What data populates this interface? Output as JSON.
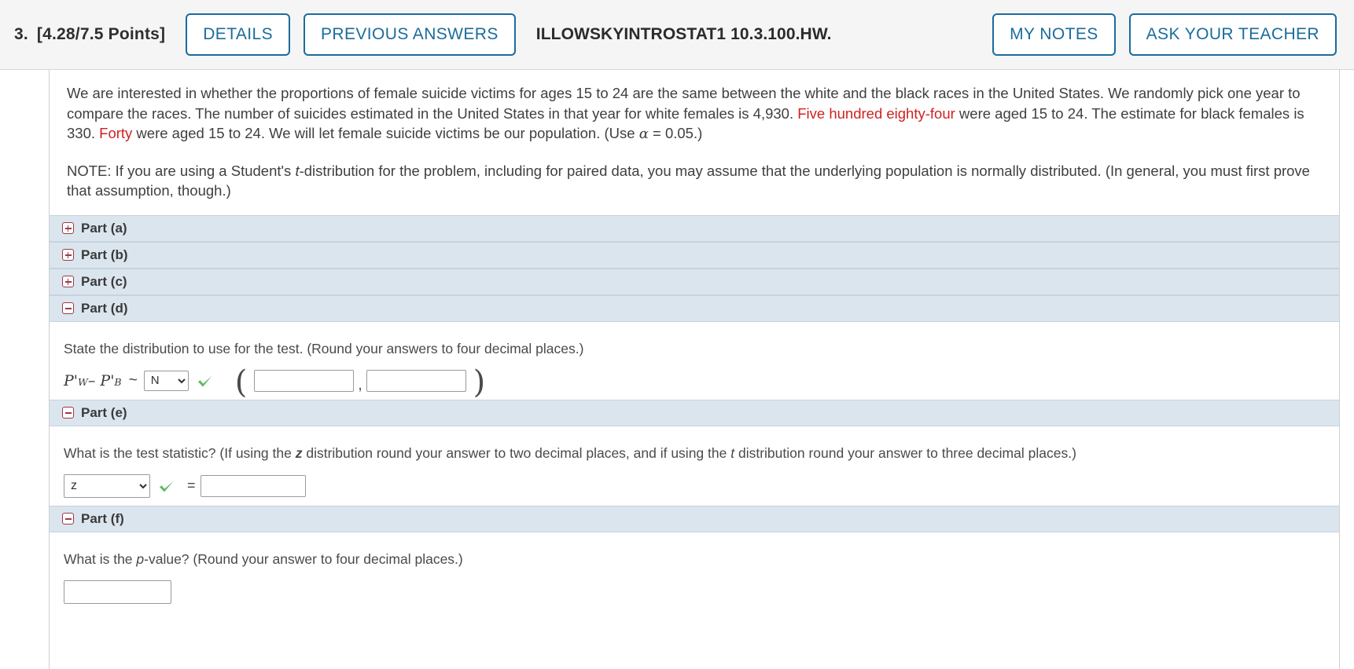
{
  "header": {
    "number": "3.",
    "points": "[4.28/7.5 Points]",
    "details_label": "DETAILS",
    "previous_answers_label": "PREVIOUS ANSWERS",
    "question_code": "ILLOWSKYINTROSTAT1 10.3.100.HW.",
    "my_notes_label": "MY NOTES",
    "ask_teacher_label": "ASK YOUR TEACHER",
    "accent_color": "#1a6c9c",
    "bar_background": "#f5f5f5"
  },
  "problem": {
    "paragraph_1_a": "We are interested in whether the proportions of female suicide victims for ages 15 to 24 are the same between the white and the black races in the United States. We randomly pick one year to compare the races. The number of suicides estimated in the United States in that year for white females is 4,930. ",
    "paragraph_1_red_1": "Five hundred eighty-four",
    "paragraph_1_b": " were aged 15 to 24. The estimate for black females is 330. ",
    "paragraph_1_red_2": "Forty",
    "paragraph_1_c": " were aged 15 to 24. We will let female suicide victims be our population. (Use ",
    "alpha_symbol": "α",
    "paragraph_1_d": " = 0.05.)",
    "note_a": "NOTE: If you are using a Student's ",
    "note_italic_t": "t",
    "note_b": "-distribution for the problem, including for paired data, you may assume that the underlying population is normally distributed. (In general, you must first prove that assumption, though.)",
    "highlight_color": "#d02121"
  },
  "parts": {
    "collapsed": [
      {
        "label": "Part (a)",
        "icon": "plus-icon",
        "state": "collapsed"
      },
      {
        "label": "Part (b)",
        "icon": "plus-icon",
        "state": "collapsed"
      },
      {
        "label": "Part (c)",
        "icon": "plus-icon",
        "state": "collapsed"
      }
    ],
    "part_d": {
      "label": "Part (d)",
      "icon": "minus-icon",
      "state": "expanded",
      "question": "State the distribution to use for the test. (Round your answers to four decimal places.)",
      "formula_left": "P'",
      "formula_sub_w": "W",
      "formula_minus": "– P'",
      "formula_sub_b": "B",
      "tilde": "~",
      "distribution_value": "N",
      "distribution_options": [
        "N"
      ],
      "checkmark": "correct-checkmark",
      "paren_open": "(",
      "comma": ",",
      "paren_close": ")",
      "mean_value": "",
      "sd_value": ""
    },
    "part_e": {
      "label": "Part (e)",
      "icon": "minus-icon",
      "state": "expanded",
      "question_a": "What is the test statistic? (If using the ",
      "question_z": "z",
      "question_b": " distribution round your answer to two decimal places, and if using the ",
      "question_t": "t",
      "question_c": " distribution round your answer to three decimal places.)",
      "statistic_value": "z",
      "statistic_options": [
        "z"
      ],
      "checkmark": "correct-checkmark",
      "equals": "=",
      "answer_value": ""
    },
    "part_f": {
      "label": "Part (f)",
      "icon": "minus-icon",
      "state": "expanded",
      "question_a": "What is the ",
      "question_p": "p",
      "question_b": "-value? (Round your answer to four decimal places.)",
      "answer_value": ""
    }
  },
  "colors": {
    "part_row_background": "#dbe5ee",
    "checkmark_green": "#5cb85c"
  }
}
